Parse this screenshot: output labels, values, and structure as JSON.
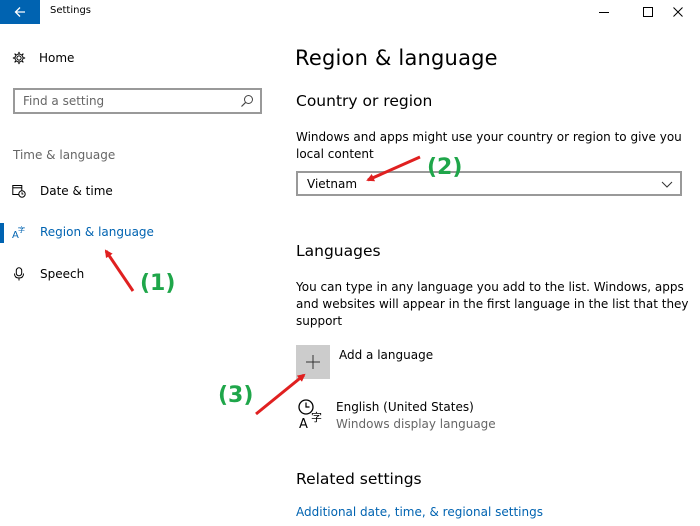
{
  "window": {
    "title": "Settings",
    "controls": [
      "minimize",
      "maximize",
      "close"
    ]
  },
  "sidebar": {
    "home_label": "Home",
    "search_placeholder": "Find a setting",
    "section_label": "Time & language",
    "items": [
      {
        "label": "Date & time",
        "icon": "calendar-clock-icon",
        "selected": false
      },
      {
        "label": "Region & language",
        "icon": "language-icon",
        "selected": true
      },
      {
        "label": "Speech",
        "icon": "microphone-icon",
        "selected": false
      }
    ]
  },
  "main": {
    "title": "Region & language",
    "country": {
      "heading": "Country or region",
      "description": "Windows and apps might use your country or region to give you local content",
      "selected_value": "Vietnam"
    },
    "languages": {
      "heading": "Languages",
      "description": "You can type in any language you add to the list. Windows, apps and websites will appear in the first language in the list that they support",
      "add_label": "Add a language",
      "installed": [
        {
          "name": "English (United States)",
          "sub": "Windows display language"
        }
      ]
    },
    "related": {
      "heading": "Related settings",
      "link": "Additional date, time, & regional settings"
    }
  },
  "annotations": {
    "label_1": "(1)",
    "label_2": "(2)",
    "label_3": "(3)",
    "arrow_color": "#e02020",
    "label_color": "#1fa64a"
  },
  "colors": {
    "accent": "#0063b1"
  }
}
